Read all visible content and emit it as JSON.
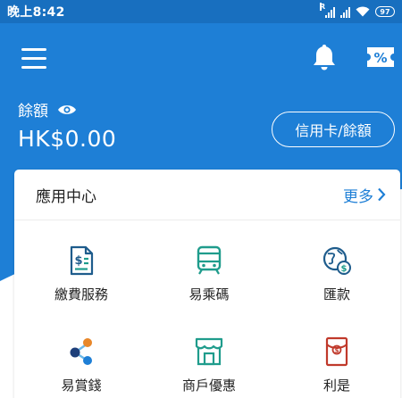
{
  "status_bar": {
    "time": "晚上8:42",
    "signal_r": "R",
    "battery": "97"
  },
  "header": {
    "balance_label": "餘額",
    "balance_amount": "HK$0.00",
    "card_button_label": "信用卡/餘額"
  },
  "app_center": {
    "title": "應用中心",
    "more_label": "更多",
    "items": [
      {
        "label": "繳費服務",
        "icon": "bill-payment-icon"
      },
      {
        "label": "易乘碼",
        "icon": "transit-code-icon"
      },
      {
        "label": "匯款",
        "icon": "remittance-icon"
      },
      {
        "label": "易賞錢",
        "icon": "rewards-icon"
      },
      {
        "label": "商戶優惠",
        "icon": "merchant-offers-icon"
      },
      {
        "label": "利是",
        "icon": "red-packet-icon"
      }
    ]
  },
  "colors": {
    "brand_blue": "#1e7fd6",
    "status_bar": "#186fbf",
    "icon_blue": "#1e5c8c",
    "icon_teal": "#1f9c8c",
    "icon_red": "#c0392b",
    "icon_orange": "#e8872a"
  }
}
